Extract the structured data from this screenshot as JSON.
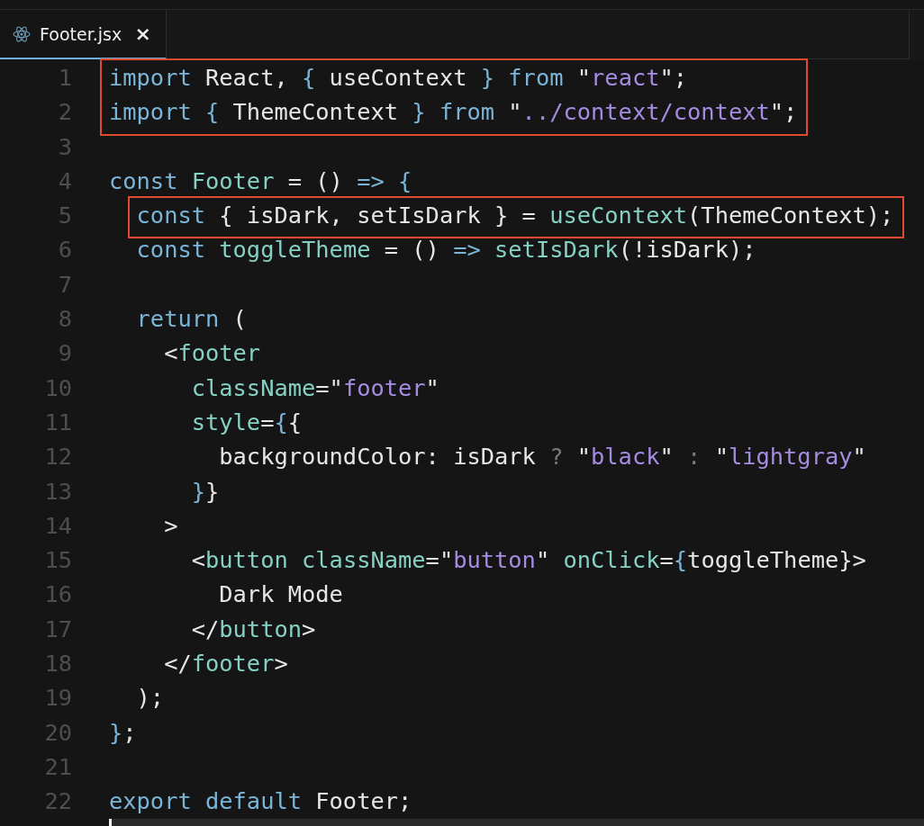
{
  "tabs": [
    {
      "label": "Footer.jsx",
      "selected": true,
      "close": "×"
    }
  ],
  "editor": {
    "lines": [
      {
        "number": "1",
        "outlined": true,
        "tokens": [
          {
            "kind": "kw",
            "text": "import"
          },
          {
            "kind": "txt",
            "text": " React, "
          },
          {
            "kind": "kw",
            "text": "{"
          },
          {
            "kind": "txt",
            "text": " useContext "
          },
          {
            "kind": "kw",
            "text": "}"
          },
          {
            "kind": "kw",
            "text": " from"
          },
          {
            "kind": "txt",
            "text": " \""
          },
          {
            "kind": "str",
            "text": "react"
          },
          {
            "kind": "txt",
            "text": "\";"
          }
        ]
      },
      {
        "number": "2",
        "outlined": true,
        "tokens": [
          {
            "kind": "kw",
            "text": "import {"
          },
          {
            "kind": "txt",
            "text": " ThemeContext "
          },
          {
            "kind": "kw",
            "text": "} from"
          },
          {
            "kind": "txt",
            "text": " \""
          },
          {
            "kind": "str",
            "text": "../context/context"
          },
          {
            "kind": "txt",
            "text": "\";"
          }
        ]
      },
      {
        "number": "3",
        "outlined": false
      },
      {
        "number": "4",
        "outlined": false,
        "tokens": [
          {
            "kind": "kw",
            "text": "const"
          },
          {
            "kind": "fn",
            "text": " Footer"
          },
          {
            "kind": "txt",
            "text": " = () "
          },
          {
            "kind": "kw",
            "text": "=> {"
          }
        ]
      },
      {
        "number": "5",
        "outlined": true,
        "tokens": [
          {
            "kind": "kw",
            "text": "  const"
          },
          {
            "kind": "txt",
            "text": " { isDark, setIsDark } = "
          },
          {
            "kind": "fn",
            "text": "useContext"
          },
          {
            "kind": "txt",
            "text": "(ThemeContext);"
          }
        ]
      },
      {
        "number": "6",
        "outlined": false,
        "tokens": [
          {
            "kind": "kw",
            "text": "  const"
          },
          {
            "kind": "fn",
            "text": " toggleTheme"
          },
          {
            "kind": "txt",
            "text": " = () "
          },
          {
            "kind": "kw",
            "text": "=>"
          },
          {
            "kind": "fn",
            "text": " setIsDark"
          },
          {
            "kind": "txt",
            "text": "(!isDark);"
          }
        ]
      },
      {
        "number": "7",
        "outlined": false
      },
      {
        "number": "8",
        "outlined": false,
        "tokens": [
          {
            "kind": "kw",
            "text": "  return"
          },
          {
            "kind": "txt",
            "text": " ("
          }
        ]
      },
      {
        "number": "9",
        "outlined": false,
        "tokens": [
          {
            "kind": "txt",
            "text": "    <"
          },
          {
            "kind": "fn",
            "text": "footer"
          }
        ]
      },
      {
        "number": "10",
        "outlined": false,
        "tokens": [
          {
            "kind": "fn",
            "text": "      className"
          },
          {
            "kind": "txt",
            "text": "=\""
          },
          {
            "kind": "str",
            "text": "footer"
          },
          {
            "kind": "txt",
            "text": "\""
          }
        ]
      },
      {
        "number": "11",
        "outlined": false,
        "tokens": [
          {
            "kind": "fn",
            "text": "      style"
          },
          {
            "kind": "txt",
            "text": "="
          },
          {
            "kind": "kw",
            "text": "{"
          },
          {
            "kind": "txt",
            "text": "{"
          }
        ]
      },
      {
        "number": "12",
        "outlined": false,
        "tokens": [
          {
            "kind": "txt",
            "text": "        backgroundColor: isDark "
          },
          {
            "kind": "op",
            "text": "?"
          },
          {
            "kind": "txt",
            "text": " \""
          },
          {
            "kind": "str",
            "text": "black"
          },
          {
            "kind": "txt",
            "text": "\" "
          },
          {
            "kind": "op",
            "text": ":"
          },
          {
            "kind": "txt",
            "text": " \""
          },
          {
            "kind": "str",
            "text": "lightgray"
          },
          {
            "kind": "txt",
            "text": "\""
          }
        ]
      },
      {
        "number": "13",
        "outlined": false,
        "tokens": [
          {
            "kind": "kw",
            "text": "      }"
          },
          {
            "kind": "txt",
            "text": "}"
          }
        ]
      },
      {
        "number": "14",
        "outlined": false,
        "tokens": [
          {
            "kind": "txt",
            "text": "    >"
          }
        ]
      },
      {
        "number": "15",
        "outlined": false,
        "tokens": [
          {
            "kind": "txt",
            "text": "      <"
          },
          {
            "kind": "fn",
            "text": "button className"
          },
          {
            "kind": "txt",
            "text": "=\""
          },
          {
            "kind": "str",
            "text": "button"
          },
          {
            "kind": "txt",
            "text": "\""
          },
          {
            "kind": "fn",
            "text": " onClick"
          },
          {
            "kind": "txt",
            "text": "="
          },
          {
            "kind": "kw",
            "text": "{"
          },
          {
            "kind": "txt",
            "text": "toggleTheme}>"
          }
        ]
      },
      {
        "number": "16",
        "outlined": false,
        "tokens": [
          {
            "kind": "txt",
            "text": "        Dark Mode"
          }
        ]
      },
      {
        "number": "17",
        "outlined": false,
        "tokens": [
          {
            "kind": "txt",
            "text": "      </"
          },
          {
            "kind": "fn",
            "text": "button"
          },
          {
            "kind": "txt",
            "text": ">"
          }
        ]
      },
      {
        "number": "18",
        "outlined": false,
        "tokens": [
          {
            "kind": "txt",
            "text": "    </"
          },
          {
            "kind": "fn",
            "text": "footer"
          },
          {
            "kind": "txt",
            "text": ">"
          }
        ]
      },
      {
        "number": "19",
        "outlined": false,
        "tokens": [
          {
            "kind": "txt",
            "text": "  );"
          }
        ]
      },
      {
        "number": "20",
        "outlined": false,
        "tokens": [
          {
            "kind": "kw",
            "text": "}"
          },
          {
            "kind": "txt",
            "text": ";"
          }
        ]
      },
      {
        "number": "21",
        "outlined": false
      },
      {
        "number": "22",
        "outlined": false,
        "tokens": [
          {
            "kind": "kw",
            "text": "export default"
          },
          {
            "kind": "txt",
            "text": " Footer;"
          }
        ]
      }
    ]
  }
}
